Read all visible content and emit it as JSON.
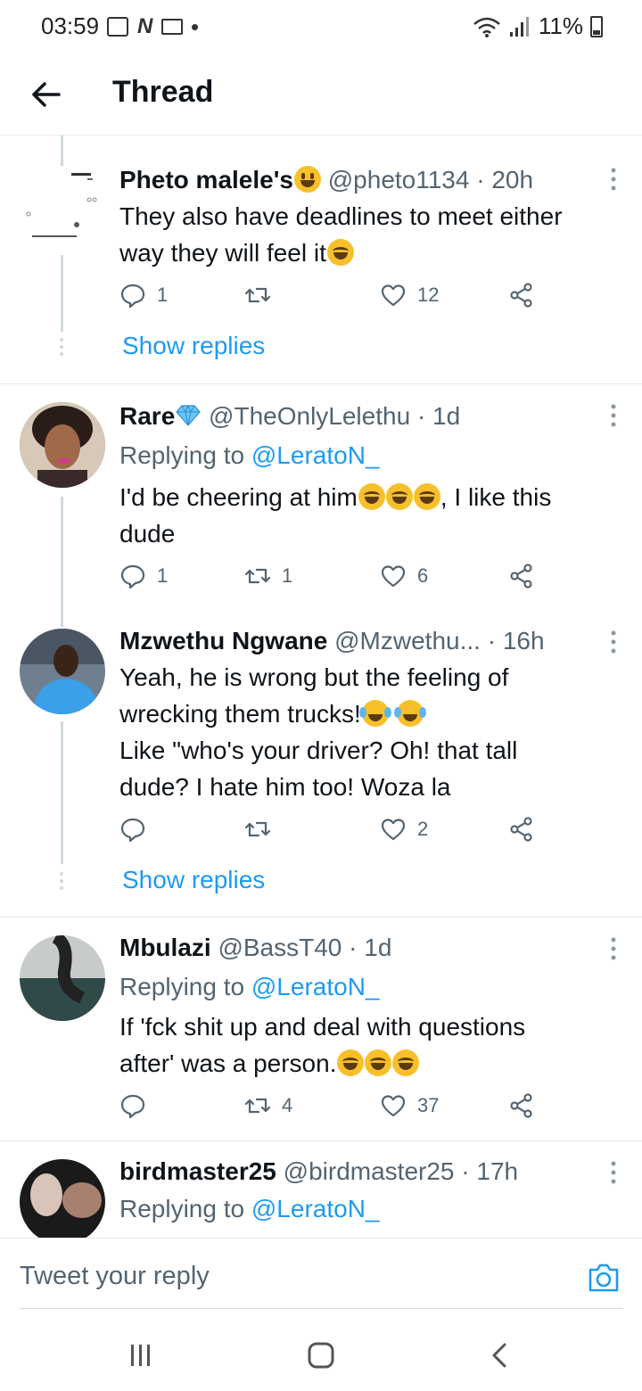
{
  "status_bar": {
    "time": "03:59",
    "battery": "11%"
  },
  "header": {
    "title": "Thread"
  },
  "tweets": [
    {
      "name": "Pheto malele's",
      "handle": "@pheto1134",
      "time": "· 20h",
      "text_line1": "They also have deadlines to meet either",
      "text_line2": "way they will feel it",
      "replies": "1",
      "retweets": "",
      "likes": "12",
      "show_replies": "Show replies"
    },
    {
      "name": "Rare",
      "handle": "@TheOnlyLelethu",
      "time": "· 1d",
      "replying_prefix": "Replying to",
      "replying_to": "@LeratoN_",
      "text_line1a": "I'd be cheering at him",
      "text_line1b": ", I like this",
      "text_line2": "dude",
      "replies": "1",
      "retweets": "1",
      "likes": "6"
    },
    {
      "name": "Mzwethu Ngwane",
      "handle": "@Mzwethu...",
      "time": "· 16h",
      "text_line1": "Yeah, he is wrong but the feeling of",
      "text_line2": "wrecking them trucks!",
      "text_line3": "Like \"who's your driver? Oh! that tall",
      "text_line4": "dude? I hate him too! Woza la",
      "replies": "",
      "retweets": "",
      "likes": "2",
      "show_replies": "Show replies"
    },
    {
      "name": "Mbulazi",
      "handle": "@BassT40",
      "time": "· 1d",
      "replying_prefix": "Replying to",
      "replying_to": "@LeratoN_",
      "text_line1": "If 'fck shit up and deal with questions",
      "text_line2": "after' was a person.",
      "replies": "",
      "retweets": "4",
      "likes": "37"
    },
    {
      "name": "birdmaster25",
      "handle": "@birdmaster25",
      "time": "· 17h",
      "replying_prefix": "Replying to",
      "replying_to": "@LeratoN_"
    }
  ],
  "reply_bar": {
    "placeholder": "Tweet your reply"
  },
  "icons": {
    "back": "arrow-left-icon",
    "more": "more-vertical-icon",
    "reply": "comment-icon",
    "retweet": "retweet-icon",
    "like": "heart-icon",
    "share": "share-icon",
    "camera": "camera-icon"
  },
  "colors": {
    "link": "#1d9bf0",
    "secondary_text": "#536471",
    "primary_text": "#0f1419"
  }
}
